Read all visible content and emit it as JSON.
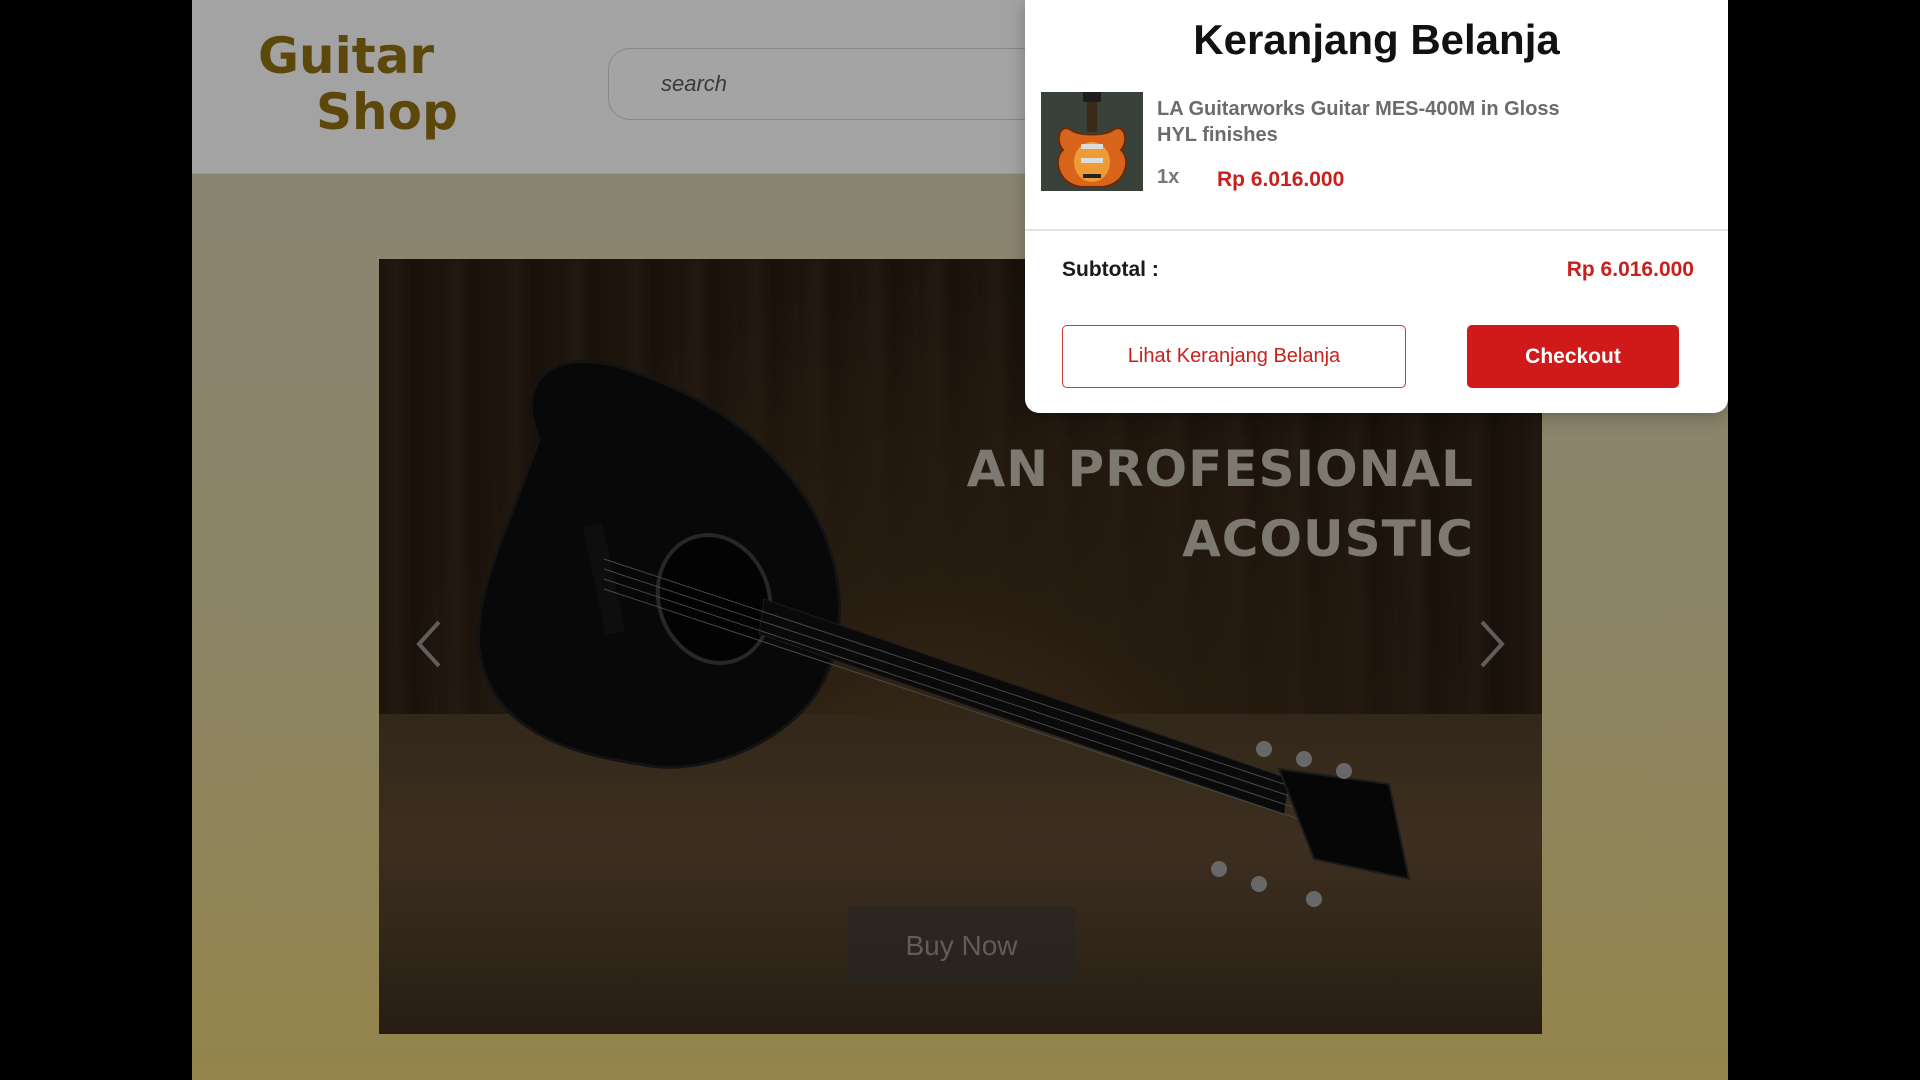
{
  "header": {
    "logo_line1": "Guitar",
    "logo_line2": "Shop",
    "search_placeholder": "search"
  },
  "hero": {
    "title_line1": "AN PROFESIONAL",
    "title_line2": "ACOUSTIC",
    "buy_button": "Buy Now",
    "prev_icon": "chevron-left-icon",
    "next_icon": "chevron-right-icon"
  },
  "cart": {
    "title": "Keranjang Belanja",
    "item": {
      "name": "LA Guitarworks Guitar MES-400M in Gloss HYL finishes",
      "quantity": "1x",
      "price": "Rp 6.016.000"
    },
    "subtotal_label": "Subtotal :",
    "subtotal_value": "Rp 6.016.000",
    "view_cart_button": "Lihat Keranjang Belanja",
    "checkout_button": "Checkout"
  },
  "colors": {
    "accent_red": "#d01a19",
    "price_red": "#c8201d",
    "logo_gold": "#8a6a12"
  }
}
